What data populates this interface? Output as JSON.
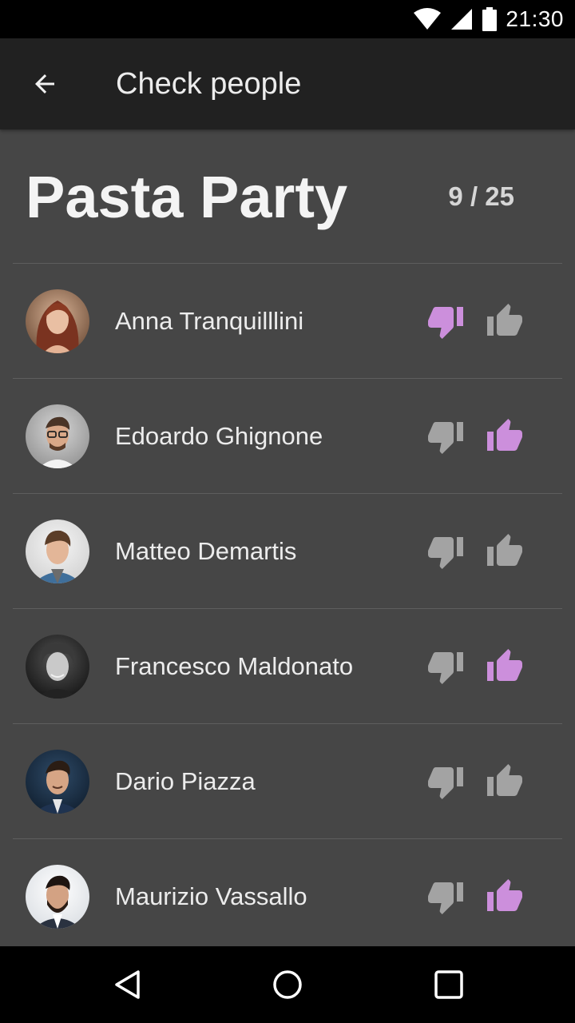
{
  "status_bar": {
    "time": "21:30",
    "icons": [
      "wifi-icon",
      "cell-signal-icon",
      "battery-icon"
    ]
  },
  "app_bar": {
    "title": "Check people",
    "back_icon": "arrow-back-icon"
  },
  "event": {
    "title": "Pasta Party",
    "counter": "9 / 25"
  },
  "colors": {
    "accent": "#cc8fdc",
    "inactive_icon": "#a3a3a3",
    "background": "#464646",
    "app_bar": "#212121"
  },
  "people": [
    {
      "name": "Anna Tranquilllini",
      "vote": "down",
      "avatar": "avatar-photo-woman-red-hair"
    },
    {
      "name": "Edoardo Ghignone",
      "vote": "up",
      "avatar": "avatar-photo-man-glasses"
    },
    {
      "name": "Matteo Demartis",
      "vote": "none",
      "avatar": "avatar-photo-man-denim-jacket"
    },
    {
      "name": "Francesco Maldonato",
      "vote": "up",
      "avatar": "avatar-photo-man-curly-hair-bw"
    },
    {
      "name": "Dario Piazza",
      "vote": "none",
      "avatar": "avatar-photo-man-suit"
    },
    {
      "name": "Maurizio Vassallo",
      "vote": "up",
      "avatar": "avatar-photo-man-beard"
    }
  ],
  "nav_bar": {
    "icons": [
      "back-triangle-icon",
      "home-circle-icon",
      "recents-square-icon"
    ]
  }
}
